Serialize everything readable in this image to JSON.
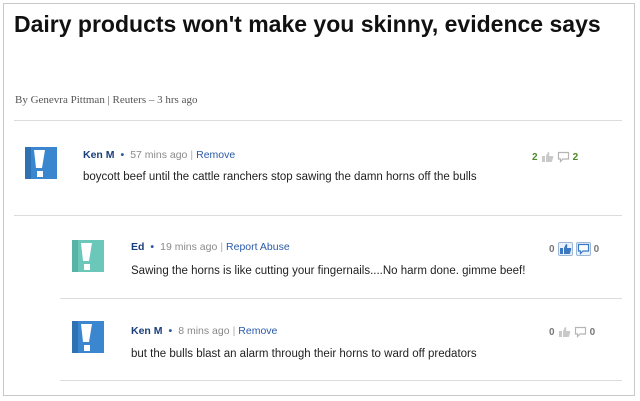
{
  "article": {
    "headline": "Dairy products won't make you skinny, evidence says",
    "byline": "By Genevra Pittman | Reuters – 3 hrs ago"
  },
  "comments": [
    {
      "user": "Ken M",
      "time": "57 mins ago",
      "action": "Remove",
      "text": "boycott beef until the cattle ranchers stop sawing the damn horns off the bulls",
      "up": "2",
      "down": "2",
      "avatar_color": "#3b87cf"
    },
    {
      "user": "Ed",
      "time": "19 mins ago",
      "action": "Report Abuse",
      "text": "Sawing the horns is like cutting your fingernails....No harm done. gimme beef!",
      "up": "0",
      "down": "0",
      "avatar_color": "#6cc7bb"
    },
    {
      "user": "Ken M",
      "time": "8 mins ago",
      "action": "Remove",
      "text": "but the bulls blast an alarm through their horns to ward off predators",
      "up": "0",
      "down": "0",
      "avatar_color": "#3b87cf"
    }
  ],
  "icons": {
    "up": "thumbs-up-icon",
    "down": "speech-bubble-icon"
  }
}
